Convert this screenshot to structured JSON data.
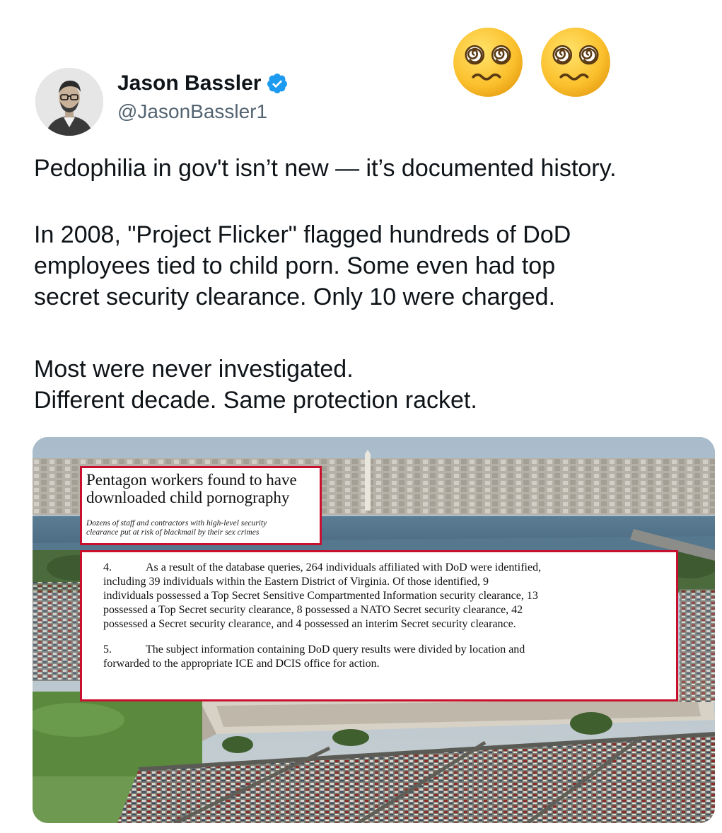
{
  "tweet": {
    "author": {
      "display_name": "Jason Bassler",
      "handle": "@JasonBassler1",
      "verified": true,
      "avatar_icon": "avatar-photo"
    },
    "paragraphs": [
      "Pedophilia in gov't isn’t new — it’s documented history.",
      "In 2008, \"Project Flicker\" flagged hundreds of DoD employees tied to child porn. Some even had top secret security clearance. Only 10 were charged.",
      "Most were never investigated. Different decade. Same protection racket."
    ],
    "paragraph_lines": {
      "p1": [
        "Pedophilia in gov't isn’t new — it’s documented history."
      ],
      "p2": [
        "In 2008, \"Project Flicker\" flagged hundreds of DoD",
        "employees tied to child porn. Some even had top",
        "secret security clearance. Only 10 were charged."
      ],
      "p3": [
        "Most were never investigated.",
        "Different decade. Same protection racket."
      ]
    },
    "overlay_emojis": [
      "woozy-face-icon",
      "woozy-face-icon"
    ]
  },
  "media": {
    "headline": "Pentagon workers found to have downloaded child pornography",
    "headline_lines": [
      "Pentagon workers found to have",
      "downloaded child pornography"
    ],
    "subhead_lines": [
      "Dozens of staff and contractors with high-level security",
      "clearance put at risk of blackmail by their sex crimes"
    ],
    "document": {
      "paragraphs": [
        {
          "number": "4.",
          "lines": [
            "As a result of the database queries, 264 individuals affiliated with DoD were identified,",
            "including 39 individuals within the Eastern District of Virginia.  Of those identified, 9",
            "individuals possessed a Top Secret Sensitive Compartmented Information security clearance, 13",
            "possessed a Top Secret security clearance, 8 possessed a NATO Secret security clearance, 42",
            "possessed a Secret security clearance, and 4 possessed an interim Secret security clearance."
          ]
        },
        {
          "number": "5.",
          "lines": [
            "The subject information containing DoD query results were divided by location and",
            "forwarded to the appropriate ICE and DCIS office for action."
          ]
        }
      ]
    },
    "colors": {
      "highlight_border": "#c8102e",
      "verified_badge": "#1d9bf0"
    }
  }
}
